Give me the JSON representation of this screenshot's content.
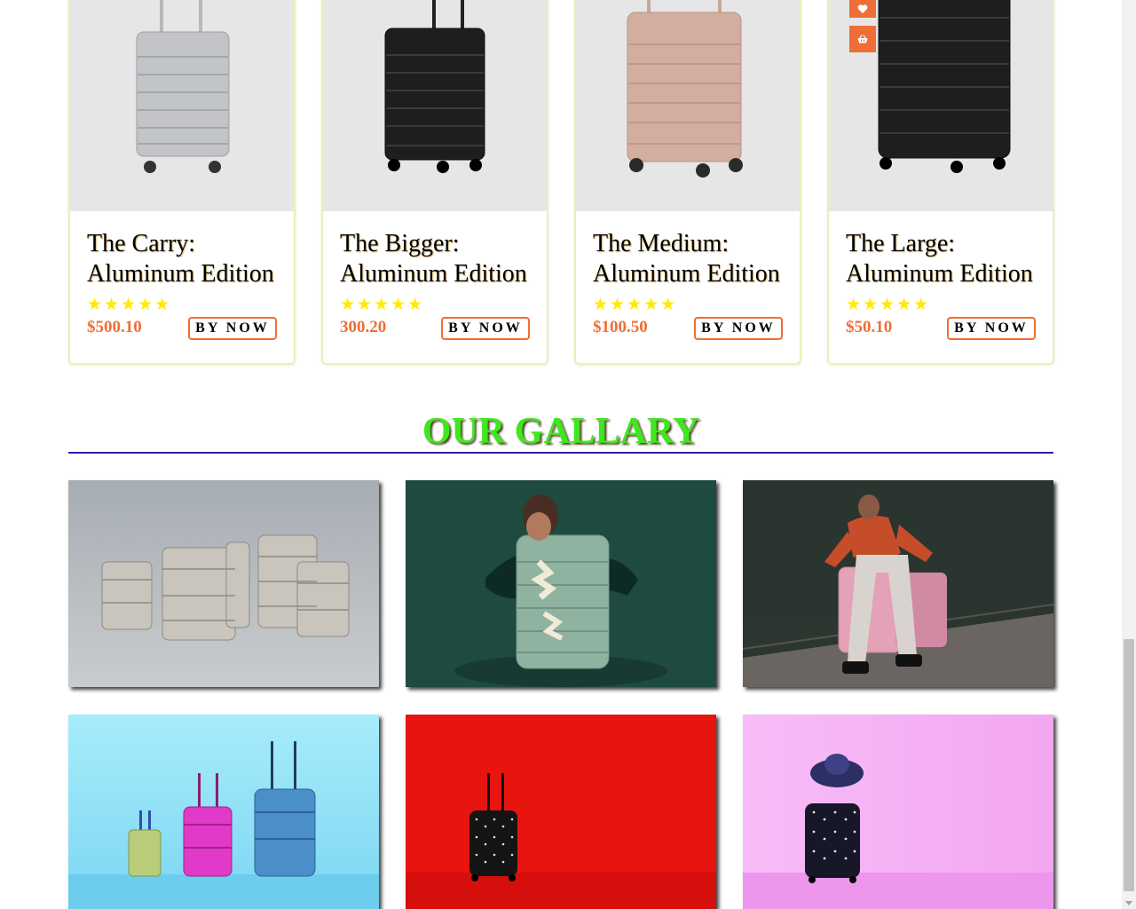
{
  "products": [
    {
      "title": "The Carry: Aluminum Edition",
      "rating": 5,
      "stars": "★★★★★",
      "price": "$500.10",
      "button": "BY NOW",
      "color": "#c2c4c8"
    },
    {
      "title": "The Bigger: Aluminum Edition",
      "rating": 5,
      "stars": "★★★★★",
      "price": "300.20",
      "button": "BY NOW",
      "color": "#1e1e1e"
    },
    {
      "title": "The Medium: Aluminum Edition",
      "rating": 5,
      "stars": "★★★★★",
      "price": "$100.50",
      "button": "BY NOW",
      "color": "#d3aea0"
    },
    {
      "title": "The Large: Aluminum Edition",
      "rating": 5,
      "stars": "★★★★★",
      "price": "$50.10",
      "button": "BY NOW",
      "color": "#1e1e1e"
    }
  ],
  "card_actions": {
    "wishlist_icon": "heart-icon",
    "cart_icon": "basket-icon"
  },
  "gallery": {
    "title": "OUR GALLARY",
    "tiles": [
      {
        "name": "luggage-set-grey",
        "bg": "#a8b0b6"
      },
      {
        "name": "person-hugging-suitcase",
        "bg": "#1f4a40"
      },
      {
        "name": "person-sitting-on-suitcase",
        "bg": "#2b3630"
      },
      {
        "name": "colorful-suitcases",
        "bg": "#8fe0f5"
      },
      {
        "name": "polka-dot-suitcase-red",
        "bg": "#e8140f"
      },
      {
        "name": "polka-dot-suitcase-pink",
        "bg": "#f5b3f5"
      }
    ]
  },
  "colors": {
    "accent": "#ef6e37",
    "gallery_title": "#3ee81d",
    "rule": "#3d1aa6",
    "star": "#ffea00"
  }
}
